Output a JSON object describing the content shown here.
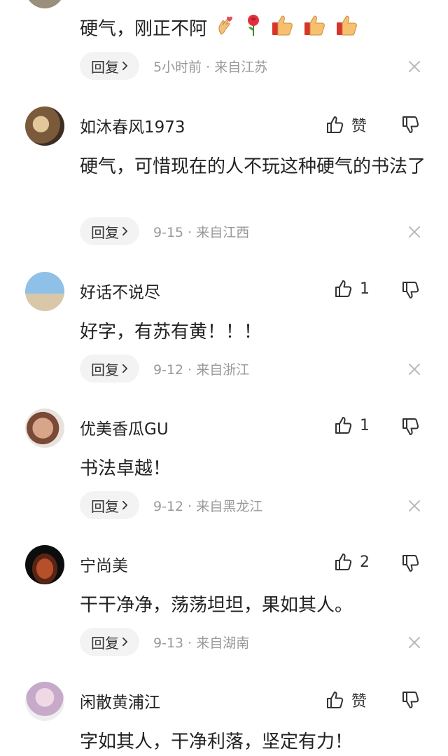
{
  "comments": [
    {
      "username": "",
      "text": "硬气，刚正不阿",
      "emojis": [
        "hand-heart-emoji",
        "rose-emoji",
        "thumbs-up-emoji",
        "thumbs-up-emoji",
        "thumbs-up-emoji"
      ],
      "reply_label": "回复",
      "time": "5小时前",
      "location": "来自江苏"
    },
    {
      "username": "如沐春风1973",
      "like_label": "赞",
      "text": "硬气，可惜现在的人不玩这种硬气的书法了",
      "reply_label": "回复",
      "time": "9-15",
      "location": "来自江西"
    },
    {
      "username": "好话不说尽",
      "like_label": "1",
      "text": "好字，有苏有黄！！！",
      "reply_label": "回复",
      "time": "9-12",
      "location": "来自浙江"
    },
    {
      "username": "优美香瓜GU",
      "like_label": "1",
      "text": "书法卓越！",
      "reply_label": "回复",
      "time": "9-12",
      "location": "来自黑龙江"
    },
    {
      "username": "宁尚美",
      "like_label": "2",
      "text": "干干净净，荡荡坦坦，果如其人。",
      "reply_label": "回复",
      "time": "9-13",
      "location": "来自湖南"
    },
    {
      "username": "闲散黄浦江",
      "like_label": "赞",
      "text": "字如其人，干净利落，坚定有力！"
    }
  ],
  "separator": "·",
  "colors": {
    "meta_gray": "#999999",
    "reply_bg": "#f3f3f3",
    "text": "#222222"
  }
}
